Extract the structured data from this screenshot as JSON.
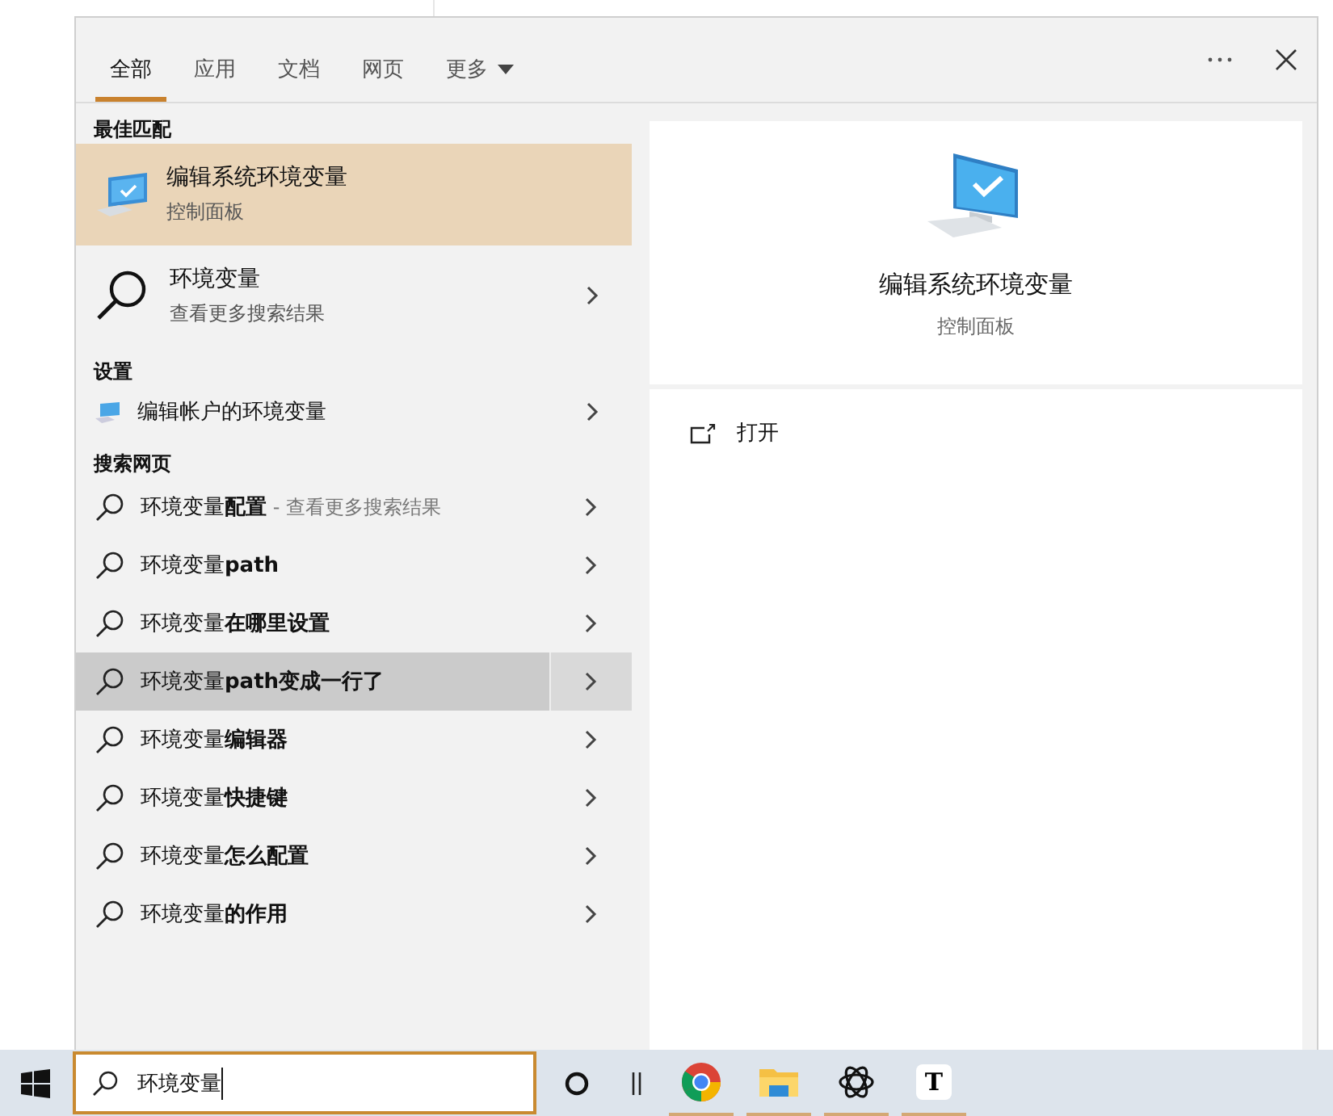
{
  "tabs": [
    {
      "label": "全部",
      "selected": true
    },
    {
      "label": "应用",
      "selected": false
    },
    {
      "label": "文档",
      "selected": false
    },
    {
      "label": "网页",
      "selected": false
    },
    {
      "label": "更多",
      "selected": false,
      "dropdown": true
    }
  ],
  "best_match": {
    "heading": "最佳匹配",
    "title": "编辑系统环境变量",
    "subtitle": "控制面板",
    "selected": true
  },
  "web_top": {
    "title": "环境变量",
    "subtitle": "查看更多搜索结果"
  },
  "settings": {
    "heading": "设置",
    "items": [
      {
        "label": "编辑帐户的环境变量"
      }
    ]
  },
  "web": {
    "heading": "搜索网页",
    "items": [
      {
        "label": "环境变量**配置**",
        "hint": " - 查看更多搜索结果",
        "selected": false
      },
      {
        "label": "环境变量**path**",
        "selected": false
      },
      {
        "label": "环境变量**在哪里设置**",
        "selected": false
      },
      {
        "label": "环境变量**path变成一行了**",
        "selected": true
      },
      {
        "label": "环境变量**编辑器**",
        "selected": false
      },
      {
        "label": "环境变量**快捷键**",
        "selected": false
      },
      {
        "label": "环境变量**怎么配置**",
        "selected": false
      },
      {
        "label": "环境变量**的作用**",
        "selected": false
      }
    ]
  },
  "preview": {
    "title": "编辑系统环境变量",
    "subtitle": "控制面板",
    "actions": [
      {
        "label": "打开"
      }
    ]
  },
  "taskbar": {
    "search_value": "环境变量",
    "apps": [
      {
        "kind": "chrome",
        "running": true
      },
      {
        "kind": "explorer",
        "running": true
      },
      {
        "kind": "openai",
        "running": true
      },
      {
        "kind": "text",
        "label": "T",
        "running": true
      }
    ]
  }
}
